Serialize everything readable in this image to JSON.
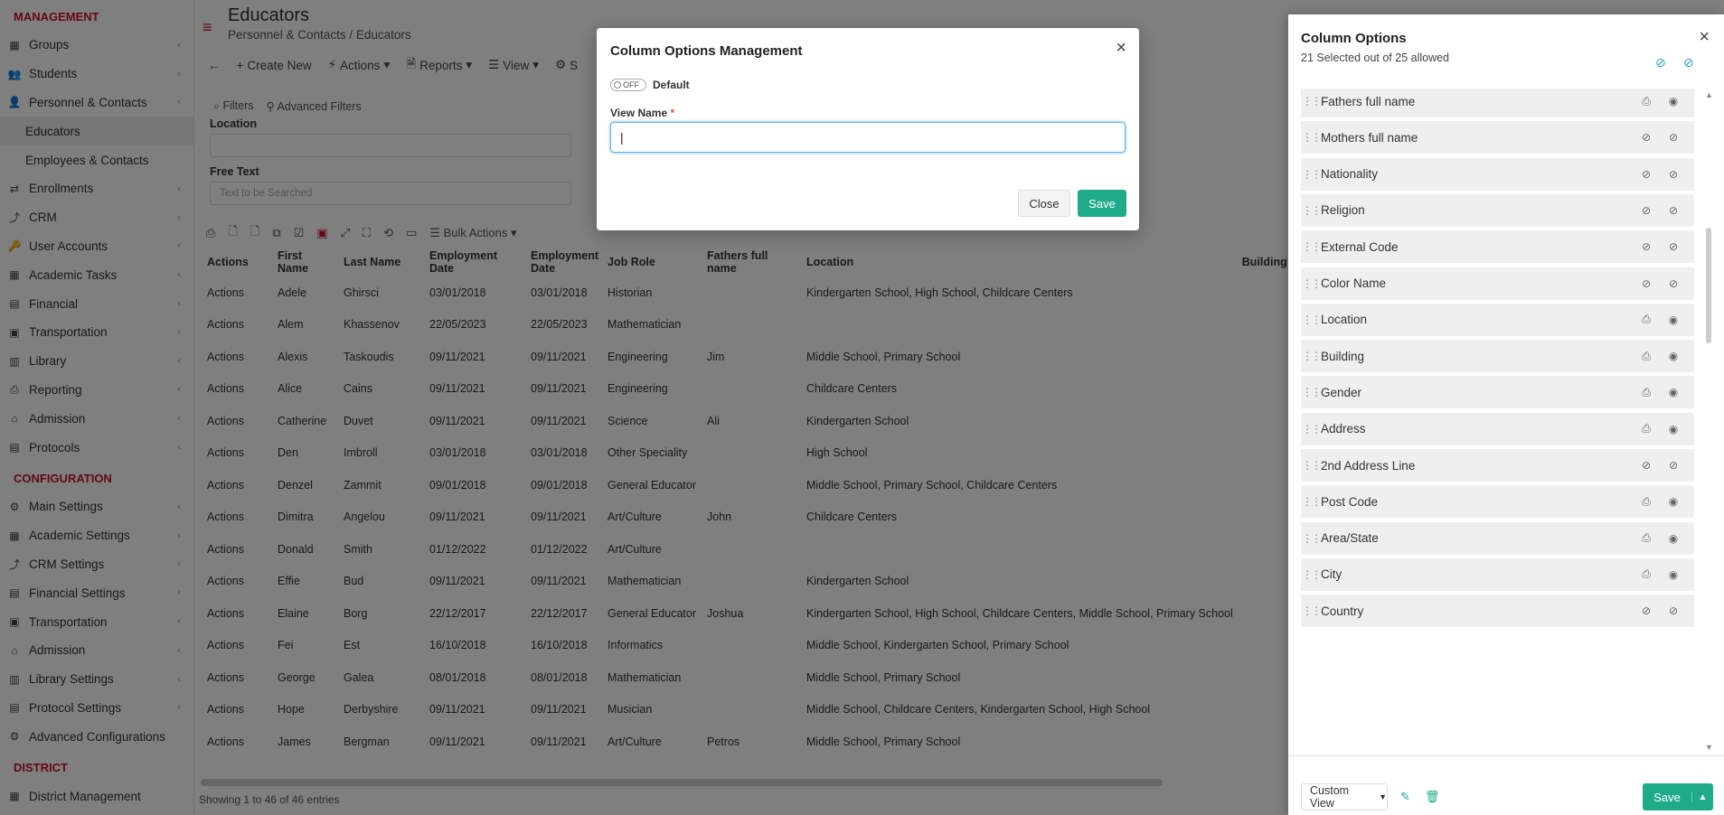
{
  "sidebar": {
    "management_label": "MANAGEMENT",
    "management": [
      {
        "label": "Groups",
        "icon": "groups-icon"
      },
      {
        "label": "Students",
        "icon": "students-icon"
      },
      {
        "label": "Personnel & Contacts",
        "icon": "personnel-icon"
      },
      {
        "label": "Educators",
        "icon": ""
      },
      {
        "label": "Employees & Contacts",
        "icon": ""
      },
      {
        "label": "Enrollments",
        "icon": "enrollments-icon"
      },
      {
        "label": "CRM",
        "icon": "crm-icon"
      },
      {
        "label": "User Accounts",
        "icon": "key-icon"
      },
      {
        "label": "Academic Tasks",
        "icon": "tasks-icon"
      },
      {
        "label": "Financial",
        "icon": "financial-icon"
      },
      {
        "label": "Transportation",
        "icon": "bus-icon"
      },
      {
        "label": "Library",
        "icon": "library-icon"
      },
      {
        "label": "Reporting",
        "icon": "print-icon"
      },
      {
        "label": "Admission",
        "icon": "admission-icon"
      },
      {
        "label": "Protocols",
        "icon": "protocols-icon"
      }
    ],
    "configuration_label": "CONFIGURATION",
    "configuration": [
      {
        "label": "Main Settings"
      },
      {
        "label": "Academic Settings"
      },
      {
        "label": "CRM Settings"
      },
      {
        "label": "Financial Settings"
      },
      {
        "label": "Transportation"
      },
      {
        "label": "Admission"
      },
      {
        "label": "Library Settings"
      },
      {
        "label": "Protocol Settings"
      },
      {
        "label": "Advanced Configurations"
      }
    ],
    "district_label": "DISTRICT",
    "district": [
      {
        "label": "District Management"
      }
    ]
  },
  "header": {
    "title": "Educators",
    "breadcrumb_1": "Personnel & Contacts",
    "breadcrumb_2": "Educators"
  },
  "toolbar": {
    "create_new": "Create New",
    "actions": "Actions",
    "reports": "Reports",
    "view": "View",
    "s": "S"
  },
  "filters": {
    "filters_label": "Filters",
    "advanced_filters": "Advanced Filters",
    "location_label": "Location",
    "free_text_label": "Free Text",
    "free_text_placeholder": "Text to be Searched",
    "bulk_actions": "Bulk Actions"
  },
  "table": {
    "headers": [
      "Actions",
      "First Name",
      "Last Name",
      "Employment Date",
      "Employment Date",
      "Job Role",
      "Fathers full name",
      "Location",
      "Building"
    ],
    "rows": [
      [
        "Actions",
        "Adele",
        "Ghirsci",
        "03/01/2018",
        "03/01/2018",
        "Historian",
        "",
        "Kindergarten School, High School, Childcare Centers"
      ],
      [
        "Actions",
        "Alem",
        "Khassenov",
        "22/05/2023",
        "22/05/2023",
        "Mathematician",
        "",
        ""
      ],
      [
        "Actions",
        "Alexis",
        "Taskoudis",
        "09/11/2021",
        "09/11/2021",
        "Engineering",
        "Jim",
        "Middle School, Primary School"
      ],
      [
        "Actions",
        "Alice",
        "Cains",
        "09/11/2021",
        "09/11/2021",
        "Engineering",
        "",
        "Childcare Centers"
      ],
      [
        "Actions",
        "Catherine",
        "Duvet",
        "09/11/2021",
        "09/11/2021",
        "Science",
        "Ali",
        "Kindergarten School"
      ],
      [
        "Actions",
        "Den",
        "Imbroll",
        "03/01/2018",
        "03/01/2018",
        "Other Speciality",
        "",
        "High School"
      ],
      [
        "Actions",
        "Denzel",
        "Zammit",
        "09/01/2018",
        "09/01/2018",
        "General Educator",
        "",
        "Middle School, Primary School, Childcare Centers"
      ],
      [
        "Actions",
        "Dimitra",
        "Angelou",
        "09/11/2021",
        "09/11/2021",
        "Art/Culture",
        "John",
        "Childcare Centers"
      ],
      [
        "Actions",
        "Donald",
        "Smith",
        "01/12/2022",
        "01/12/2022",
        "Art/Culture",
        "",
        ""
      ],
      [
        "Actions",
        "Effie",
        "Bud",
        "09/11/2021",
        "09/11/2021",
        "Mathematician",
        "",
        "Kindergarten School"
      ],
      [
        "Actions",
        "Elaine",
        "Borg",
        "22/12/2017",
        "22/12/2017",
        "General Educator",
        "Joshua",
        "Kindergarten School, High School, Childcare Centers, Middle School, Primary School"
      ],
      [
        "Actions",
        "Fei",
        "Est",
        "16/10/2018",
        "16/10/2018",
        "Informatics",
        "",
        "Middle School, Kindergarten School, Primary School"
      ],
      [
        "Actions",
        "George",
        "Galea",
        "08/01/2018",
        "08/01/2018",
        "Mathematician",
        "",
        "Middle School, Primary School"
      ],
      [
        "Actions",
        "Hope",
        "Derbyshire",
        "09/11/2021",
        "09/11/2021",
        "Musician",
        "",
        "Middle School, Childcare Centers, Kindergarten School, High School"
      ],
      [
        "Actions",
        "James",
        "Bergman",
        "09/11/2021",
        "09/11/2021",
        "Art/Culture",
        "Petros",
        "Middle School, Primary School"
      ]
    ],
    "footer": "Showing 1 to 46 of 46 entries"
  },
  "modal": {
    "title": "Column Options Management",
    "toggle_state": "OFF",
    "default_label": "Default",
    "view_name_label": "View Name",
    "required_mark": "*",
    "view_name_value": "",
    "close_label": "Close",
    "save_label": "Save"
  },
  "panel": {
    "title": "Column Options",
    "subtitle": "21 Selected out of 25 allowed",
    "items": [
      {
        "name": "Fathers full name",
        "visible": true
      },
      {
        "name": "Mothers full name",
        "visible": false
      },
      {
        "name": "Nationality",
        "visible": false
      },
      {
        "name": "Religion",
        "visible": false
      },
      {
        "name": "External Code",
        "visible": false
      },
      {
        "name": "Color Name",
        "visible": false
      },
      {
        "name": "Location",
        "visible": true
      },
      {
        "name": "Building",
        "visible": true
      },
      {
        "name": "Gender",
        "visible": true
      },
      {
        "name": "Address",
        "visible": true
      },
      {
        "name": "2nd Address Line",
        "visible": false
      },
      {
        "name": "Post Code",
        "visible": true
      },
      {
        "name": "Area/State",
        "visible": true
      },
      {
        "name": "City",
        "visible": true
      },
      {
        "name": "Country",
        "visible": false
      }
    ],
    "custom_view": "Custom View",
    "save_label": "Save"
  },
  "colors": {
    "accent": "#1fab89",
    "brand_red": "#c8102e"
  }
}
